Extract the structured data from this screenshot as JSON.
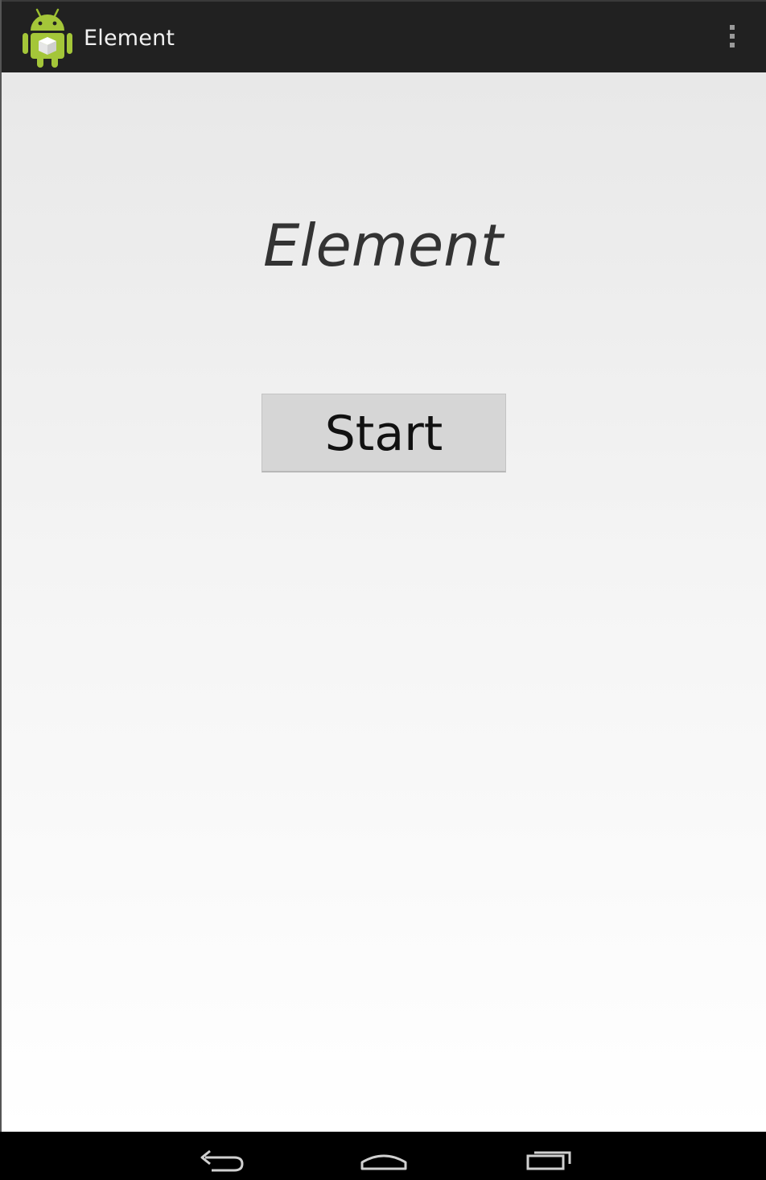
{
  "action_bar": {
    "title": "Element",
    "app_icon": "android-robot-icon",
    "overflow_icon": "overflow-menu-icon",
    "background": "#212121"
  },
  "main": {
    "heading": "Element",
    "start_label": "Start"
  },
  "nav_bar": {
    "back_icon": "back-icon",
    "home_icon": "home-icon",
    "recents_icon": "recents-icon"
  },
  "colors": {
    "android_green": "#A4C639",
    "button_gray": "#D6D6D6"
  }
}
